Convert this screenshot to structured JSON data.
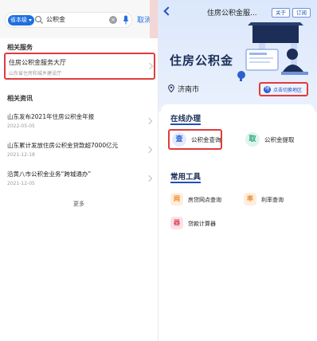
{
  "left": {
    "search": {
      "scope": "省本级",
      "query": "公积金",
      "cancel": "取消"
    },
    "services_heading": "相关服务",
    "service": {
      "name": "住房公积金服务大厅",
      "provider": "山东省住房和城乡建设厅"
    },
    "news_heading": "相关资讯",
    "news": [
      {
        "title": "山东发布2021年住房公积金年报",
        "date": "2022-05-05"
      },
      {
        "title": "山东累计发放住房公积金贷款超7000亿元",
        "date": "2021-12-18"
      },
      {
        "title": "沿黄八市公积金业务“跨城通办”",
        "date": "2021-12-05"
      }
    ],
    "more": "更多"
  },
  "right": {
    "header_title": "住房公积金服...",
    "about": "关于",
    "subscribe": "订阅",
    "hero_title": "住房公积金",
    "city": "济南市",
    "switch_icon": "地",
    "switch_label": "点击切换地区",
    "online_heading": "在线办理",
    "online": [
      {
        "icon": "查",
        "label": "公积金查询",
        "color": "#2d5fd0",
        "bg": "#e3ebfb"
      },
      {
        "icon": "取",
        "label": "公积金提取",
        "color": "#21a67a",
        "bg": "#dff4ec"
      }
    ],
    "tools_heading": "常用工具",
    "tools": [
      {
        "icon": "网",
        "label": "房贷网点查询",
        "color": "#f08a2c",
        "bg": "#fdeedd"
      },
      {
        "icon": "率",
        "label": "利率查询",
        "color": "#f08a2c",
        "bg": "#fdeedd"
      },
      {
        "icon": "器",
        "label": "贷款计算器",
        "color": "#e0465a",
        "bg": "#fbe2e6"
      }
    ]
  }
}
